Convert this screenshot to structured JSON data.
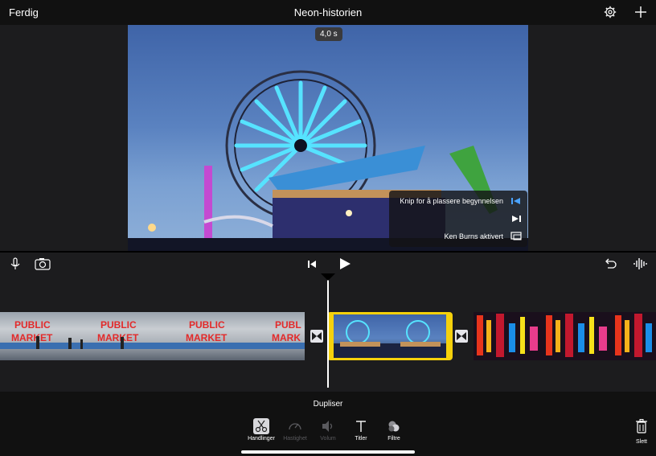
{
  "header": {
    "done_label": "Ferdig",
    "project_title": "Neon-historien"
  },
  "viewer": {
    "duration": "4,0 s",
    "tips": {
      "trim_start": "Knip for å plassere begynnelsen",
      "ken_burns": "Ken Burns aktivert"
    }
  },
  "bottom": {
    "action_title": "Dupliser",
    "tools": [
      {
        "label": "Handlinger",
        "icon": "scissors-icon",
        "active": true
      },
      {
        "label": "Hastighet",
        "icon": "speedometer-icon",
        "active": false
      },
      {
        "label": "Volum",
        "icon": "speaker-icon",
        "active": false
      },
      {
        "label": "Titler",
        "icon": "title-t-icon",
        "active": false
      },
      {
        "label": "Filtre",
        "icon": "filters-icon",
        "active": false
      }
    ],
    "delete_label": "Slett"
  },
  "clips": {
    "clip1_text": "PUBLIC MARKET"
  },
  "colors": {
    "accent_yellow": "#f5d10c",
    "tip_blue": "#4aa3ff"
  }
}
